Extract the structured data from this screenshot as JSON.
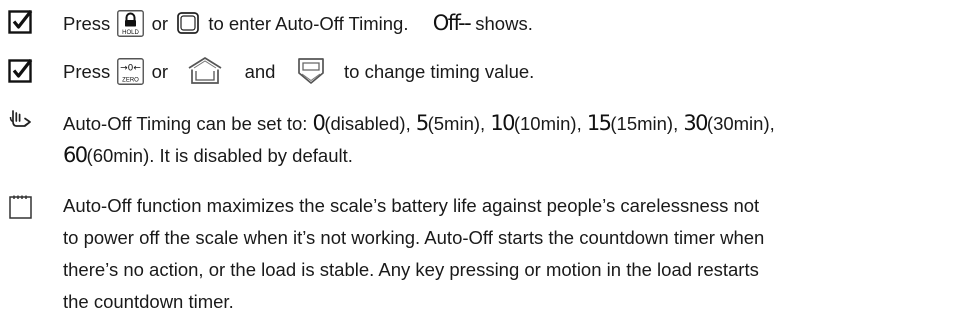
{
  "step1": {
    "press": "Press",
    "or": "or",
    "rest": "to enter Auto-Off Timing.",
    "display": "Off--",
    "shows": "shows.",
    "hold_key_label": "HOLD"
  },
  "step2": {
    "press": "Press",
    "or": "or",
    "and": "and",
    "rest": "to change timing value.",
    "zero_key_label": "ZERO",
    "zero_key_symbol": "→0←"
  },
  "tip": {
    "intro": "Auto-Off Timing can be set to:",
    "options": [
      {
        "value": "0",
        "desc": "(disabled)"
      },
      {
        "value": "5",
        "desc": "(5min)"
      },
      {
        "value": "10",
        "desc": "(10min)"
      },
      {
        "value": "15",
        "desc": "(15min)"
      },
      {
        "value": "30",
        "desc": "(30min)"
      },
      {
        "value": "60",
        "desc": "(60min)"
      }
    ],
    "default_note": "It is disabled by default."
  },
  "note": {
    "lines": [
      "Auto-Off function maximizes the scale’s battery life against people’s carelessness not",
      "to power off the scale when it’s not working. Auto-Off starts the countdown timer when",
      "there’s no action, or the load is stable. Any key pressing or motion in the load restarts",
      "the countdown timer."
    ]
  }
}
